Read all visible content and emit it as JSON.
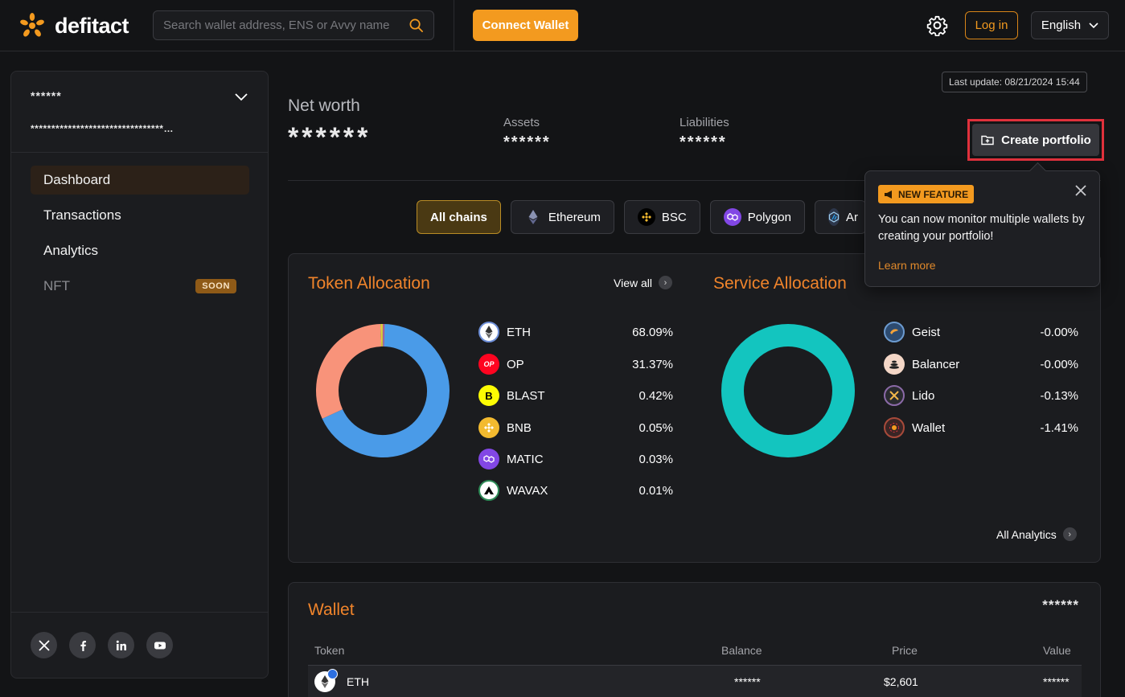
{
  "header": {
    "logo_text": "defitact",
    "search_placeholder": "Search wallet address, ENS or Avvy name",
    "connect_label": "Connect Wallet",
    "login_label": "Log in",
    "language": "English"
  },
  "sidebar": {
    "account_name": "******",
    "account_address": "********************************…",
    "items": [
      {
        "label": "Dashboard",
        "active": true
      },
      {
        "label": "Transactions"
      },
      {
        "label": "Analytics"
      },
      {
        "label": "NFT",
        "badge": "SOON",
        "disabled": true
      }
    ],
    "socials": [
      "x-icon",
      "facebook-icon",
      "linkedin-icon",
      "youtube-icon"
    ]
  },
  "summary": {
    "last_update": "Last update: 08/21/2024 15:44",
    "net_worth_label": "Net worth",
    "net_worth_value": "******",
    "assets_label": "Assets",
    "assets_value": "******",
    "liabilities_label": "Liabilities",
    "liabilities_value": "******",
    "create_portfolio_label": "Create portfolio"
  },
  "chains": [
    {
      "label": "All chains",
      "active": true
    },
    {
      "label": "Ethereum",
      "icon": "ethereum-icon"
    },
    {
      "label": "BSC",
      "icon": "bnb-icon"
    },
    {
      "label": "Polygon",
      "icon": "polygon-icon"
    },
    {
      "label": "Ar",
      "icon": "arbitrum-icon"
    }
  ],
  "token_allocation": {
    "title": "Token Allocation",
    "view_all": "View all",
    "items": [
      {
        "name": "ETH",
        "pct": "68.09%",
        "value": 68.09,
        "color": "#4a9be8"
      },
      {
        "name": "OP",
        "pct": "31.37%",
        "value": 31.37,
        "color": "#f8937a"
      },
      {
        "name": "BLAST",
        "pct": "0.42%",
        "value": 0.42,
        "color": "#d8d63a"
      },
      {
        "name": "BNB",
        "pct": "0.05%",
        "value": 0.05,
        "color": "#f3ba2f"
      },
      {
        "name": "MATIC",
        "pct": "0.03%",
        "value": 0.03,
        "color": "#8247e5"
      },
      {
        "name": "WAVAX",
        "pct": "0.01%",
        "value": 0.01,
        "color": "#e84142"
      }
    ]
  },
  "service_allocation": {
    "title": "Service Allocation",
    "items": [
      {
        "name": "Geist",
        "pct": "-0.00%"
      },
      {
        "name": "Balancer",
        "pct": "-0.00%"
      },
      {
        "name": "Lido",
        "pct": "-0.13%"
      },
      {
        "name": "Wallet",
        "pct": "-1.41%"
      }
    ],
    "ring_color": "#13c5bf",
    "all_analytics": "All Analytics"
  },
  "tooltip": {
    "badge": "NEW FEATURE",
    "text": "You can now monitor multiple wallets by creating your portfolio!",
    "link": "Learn more"
  },
  "wallet": {
    "title": "Wallet",
    "total": "******",
    "columns": [
      "Token",
      "Balance",
      "Price",
      "Value"
    ],
    "rows": [
      {
        "token": "ETH",
        "balance": "******",
        "price": "$2,601",
        "value": "******"
      }
    ]
  }
}
